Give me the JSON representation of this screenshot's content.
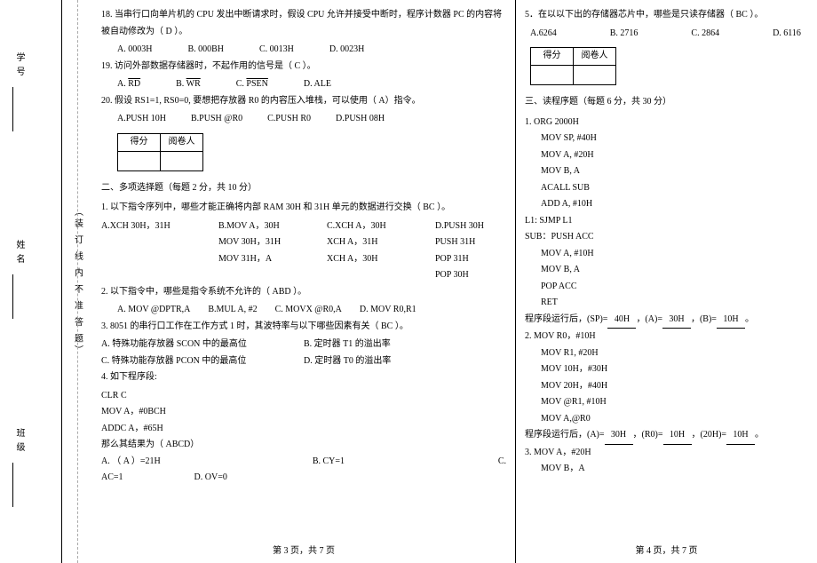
{
  "margin": {
    "class": "班级",
    "name": "姓名",
    "id": "学号",
    "binding": "（装 订 线 内 不 准 答 题）"
  },
  "left": {
    "q18": "18. 当串行口向单片机的 CPU 发出中断请求时，假设 CPU 允许并接受中断时，程序计数器 PC 的内容将被自动修改为（ D  ）。",
    "q18opts": [
      "A. 0003H",
      "B. 000BH",
      "C. 0013H",
      "D. 0023H"
    ],
    "q19": "19. 访问外部数据存储器时，不起作用的信号是（ C  ）。",
    "q19opts": [
      "A. RD",
      "B. WR",
      "C. PSEN",
      "D. ALE"
    ],
    "q20": "20. 假设 RS1=1, RS0=0, 要想把存放器 R0 的内容压入堆栈，可以使用（  A）指令。",
    "q20opts": [
      "A.PUSH  10H",
      "B.PUSH  @R0",
      "C.PUSH  R0",
      "D.PUSH  08H"
    ],
    "scoreHdr": [
      "得分",
      "阅卷人"
    ],
    "sec2title": "二、多项选择题（每题 2 分，共 10 分）",
    "m1": "1. 以下指令序列中，哪些才能正确将内部 RAM  30H 和 31H 单元的数据进行交换（        BC   ）。",
    "m1a": "A.XCH 30H，31H",
    "m1b1": "B.MOV A，30H",
    "m1b2": "MOV 30H，31H",
    "m1b3": "MOV 31H，A",
    "m1c1": "C.XCH  A，30H",
    "m1c2": "XCH  A，31H",
    "m1c3": "XCH  A，30H",
    "m1d1": "D.PUSH 30H",
    "m1d2": "PUSH 31H",
    "m1d3": "POP 31H",
    "m1d4": "POP 30H",
    "m2": "2. 以下指令中，哪些是指令系统不允许的（      ABD     ）。",
    "m2opts": [
      "A.  MOV @DPTR,A",
      "B.MUL A, #2",
      "C.  MOVX @R0,A",
      "D. MOV R0,R1"
    ],
    "m3": "3. 8051 的串行口工作在工作方式 1 时，其波特率与以下哪些因素有关（      BC    ）。",
    "m3a": "A. 特殊功能存放器 SCON 中的最高位",
    "m3b": "B. 定时器 T1 的溢出率",
    "m3c": "C. 特殊功能存放器 PCON 中的最高位",
    "m3d": "D. 定时器 T0 的溢出率",
    "m4": "4. 如下程序段:",
    "m4l1": "CLR    C",
    "m4l2": "MOV    A，#0BCH",
    "m4l3": "ADDC   A，#65H",
    "m4q": "那么其结果为（      ABCD）",
    "m4a": "A.  （  A  ）=21H",
    "m4b": "B.  CY=1",
    "m4c": "C.",
    "m4c2": "AC=1",
    "m4d": "D. OV=0",
    "footerL": "第 3 页，共 7 页"
  },
  "right": {
    "q5": "5．在以以下出的存储器芯片中，哪些是只读存储器（    BC          ）。",
    "q5opts": [
      "A.6264",
      "B. 2716",
      "C. 2864",
      "D. 6116"
    ],
    "scoreHdr": [
      "得分",
      "阅卷人"
    ],
    "sec3title": "三、读程序题（每题 6 分，共 30 分）",
    "p1": "1. ORG 2000H",
    "p1l": [
      "MOV SP, #40H",
      "MOV A, #20H",
      "MOV B, A",
      "ACALL SUB",
      "ADD A, #10H"
    ],
    "p1l1": "L1:  SJMP L1",
    "p1sub": "SUB：PUSH ACC",
    "p1subl": [
      "MOV A, #10H",
      "MOV B, A",
      "POP ACC",
      "RET"
    ],
    "ans1a": "程序段运行后，(SP)=",
    "ans1a_v1": "40H",
    "ans1a_m": "，(A)=",
    "ans1a_v2": "30H",
    "ans1a_m2": "，(B)=",
    "ans1a_v3": "10H",
    "ans1a_e": "。",
    "p2": "2. MOV R0，#10H",
    "p2l": [
      "MOV R1, #20H",
      "MOV 10H，#30H",
      "MOV 20H，#40H",
      "MOV @R1, #10H",
      "MOV A,@R0"
    ],
    "ans2a": "程序段运行后，(A)=",
    "ans2a_v1": "30H",
    "ans2a_m": "，(R0)=",
    "ans2a_v2": "10H",
    "ans2a_m2": "，(20H)=",
    "ans2a_v3": "10H",
    "ans2a_e": "。",
    "p3": "3. MOV A，#20H",
    "p3l": [
      "MOV B，A"
    ],
    "footerR": "第 4 页，共 7 页"
  }
}
